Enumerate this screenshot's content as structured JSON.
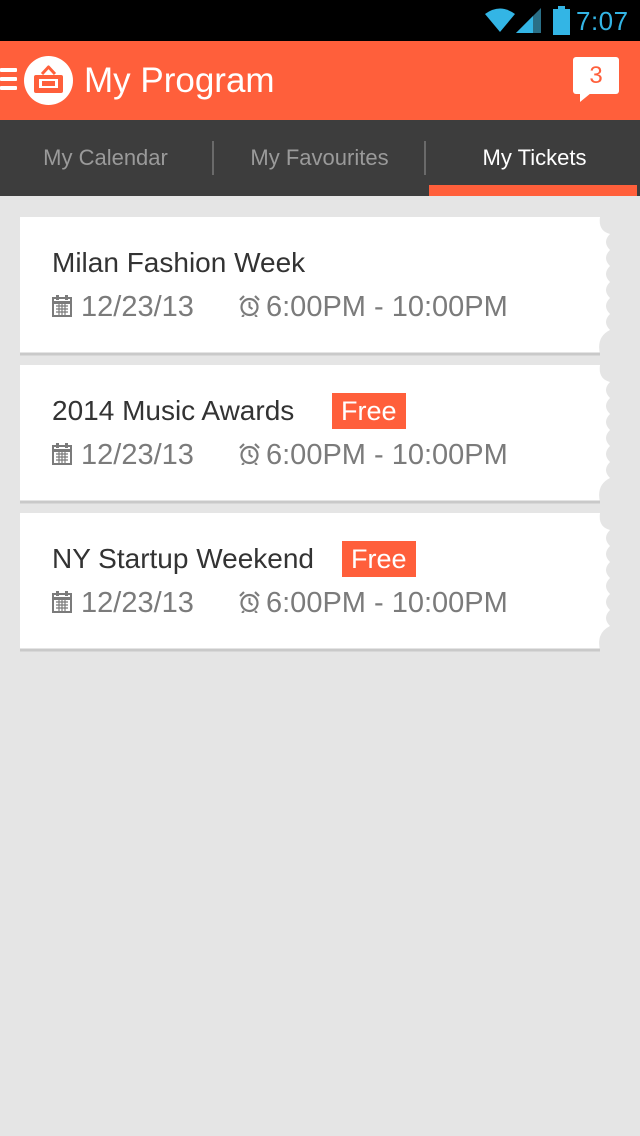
{
  "status_bar": {
    "time": "7:07",
    "icons": [
      "wifi-icon",
      "cell-signal-icon",
      "battery-icon"
    ],
    "accent_color": "#33b5e5"
  },
  "action_bar": {
    "title": "My Program",
    "notification_count": "3",
    "background_color": "#ff5f3b",
    "icons": [
      "menu-icon",
      "app-logo-icon",
      "notification-bubble-icon"
    ]
  },
  "tabs": {
    "items": [
      {
        "label": "My Calendar",
        "active": false
      },
      {
        "label": "My Favourites",
        "active": false
      },
      {
        "label": "My Tickets",
        "active": true
      }
    ],
    "background_color": "#3d3d3d",
    "indicator_color": "#ff5f3b"
  },
  "tickets": [
    {
      "title": "Milan Fashion Week",
      "badge": "",
      "date": "12/23/13",
      "time_range": "6:00PM - 10:00PM"
    },
    {
      "title": "2014 Music Awards",
      "badge": "Free",
      "date": "12/23/13",
      "time_range": "6:00PM - 10:00PM"
    },
    {
      "title": "NY Startup Weekend",
      "badge": "Free",
      "date": "12/23/13",
      "time_range": "6:00PM - 10:00PM"
    }
  ],
  "ticket_icons": [
    "calendar-icon",
    "alarm-clock-icon"
  ],
  "colors": {
    "page_background": "#e5e5e5",
    "card_background": "#ffffff",
    "badge_background": "#ff5f3b",
    "title_text": "#333333",
    "meta_text": "#7b7b7b"
  }
}
